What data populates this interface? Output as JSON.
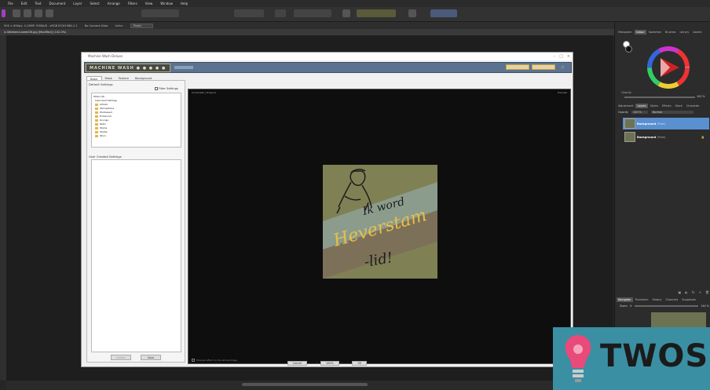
{
  "menu": [
    "File",
    "Edit",
    "Text",
    "Document",
    "Layer",
    "Select",
    "Arrange",
    "Filters",
    "View",
    "Window",
    "Help"
  ],
  "context_bar": {
    "info": "900 × 600px, 0,16MP, RGBA/8 - sRGB IEC61966-2.1",
    "camera": "No Camera Data",
    "units_label": "Units:",
    "units_value": "Pixels"
  },
  "document_tab": "ic-Weekend-week06.jpg [Modified] (102.0%)",
  "plugin": {
    "window_title": "Machine Wash Deluxe",
    "logo": "MACHINE WASH",
    "tabs": [
      "Basic",
      "Mask",
      "Texture",
      "Background"
    ],
    "default_settings_label": "Default Settings",
    "filter_settings_label": "Filter Settings",
    "tree_items": [
      "Filters (6)",
      "Last Used Settings",
      "Artistic",
      "Atmosphere",
      "Distressed",
      "Enhanced",
      "Grunge",
      "Retro",
      "Stains",
      "Textile",
      "Worn"
    ],
    "user_settings_label": "User Created Settings",
    "delete_label": "Delete",
    "save_label": "Save",
    "preview_mode": "Composite | Original",
    "preview_right": "Preview",
    "preview_check_label": "Preview effect on the whole image",
    "cancel_label": "Cancel",
    "zoom_value": "100%",
    "ok_label": "OK"
  },
  "poster": {
    "line1": "Ik word",
    "line2": "Heverstam",
    "line3": "-lid!"
  },
  "right_panel": {
    "tabs_top": [
      "Histogram",
      "Colour",
      "Swatches",
      "Brushes",
      "Library",
      "Assets"
    ],
    "opacity_label": "Opacity",
    "opacity_value": "100 %",
    "tabs_mid": [
      "Adjustment",
      "Layers",
      "Styles",
      "Effects",
      "Stock",
      "Character"
    ],
    "layers_opacity": "100 %",
    "blend_mode": "Normal",
    "layers": [
      {
        "name": "Background",
        "type": "(Pixel)"
      },
      {
        "name": "Background",
        "type": "(Pixel)"
      }
    ],
    "tabs_bottom": [
      "Navigator",
      "Transform",
      "History",
      "Channels",
      "Snapshots"
    ],
    "zoom_label": "Zoom",
    "zoom_value": "144 %"
  },
  "watermark": "TWOS",
  "colors": {
    "accent": "#5b7390",
    "gold": "#c9a24b",
    "logo_bg": "#3a8fa3"
  }
}
